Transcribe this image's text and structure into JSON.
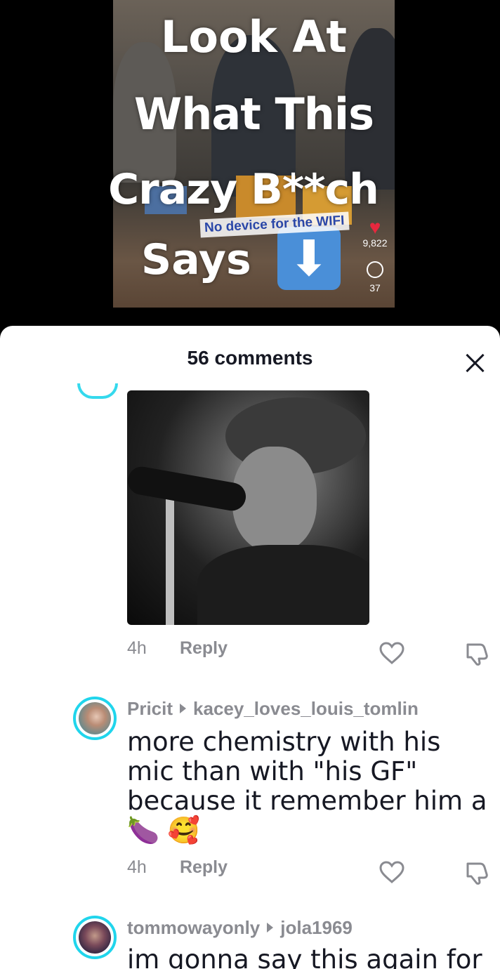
{
  "video": {
    "overlay_lines": [
      "Look At",
      "What This",
      "Crazy B**ch",
      "Says"
    ],
    "arrow_emoji": "⬇",
    "sticker_text": "No device for the WIFI",
    "like_count": "9,822",
    "comment_count": "37"
  },
  "comments_sheet": {
    "title": "56 comments",
    "comments": [
      {
        "time": "4h",
        "reply_label": "Reply"
      },
      {
        "author": "Pricit",
        "reply_to": "kacey_loves_louis_tomlin",
        "text": "more chemistry with his mic than with \"his GF\" because it remember him a",
        "emojis": "🍆 🥰",
        "time": "4h",
        "reply_label": "Reply"
      },
      {
        "author": "tommowayonly",
        "reply_to": "jola1969",
        "text": "im gonna say this again for"
      }
    ]
  },
  "colors": {
    "accent_ring": "#20d5ec",
    "heart": "#e8283e",
    "muted_text": "#8a8b91",
    "primary_text": "#161823"
  }
}
